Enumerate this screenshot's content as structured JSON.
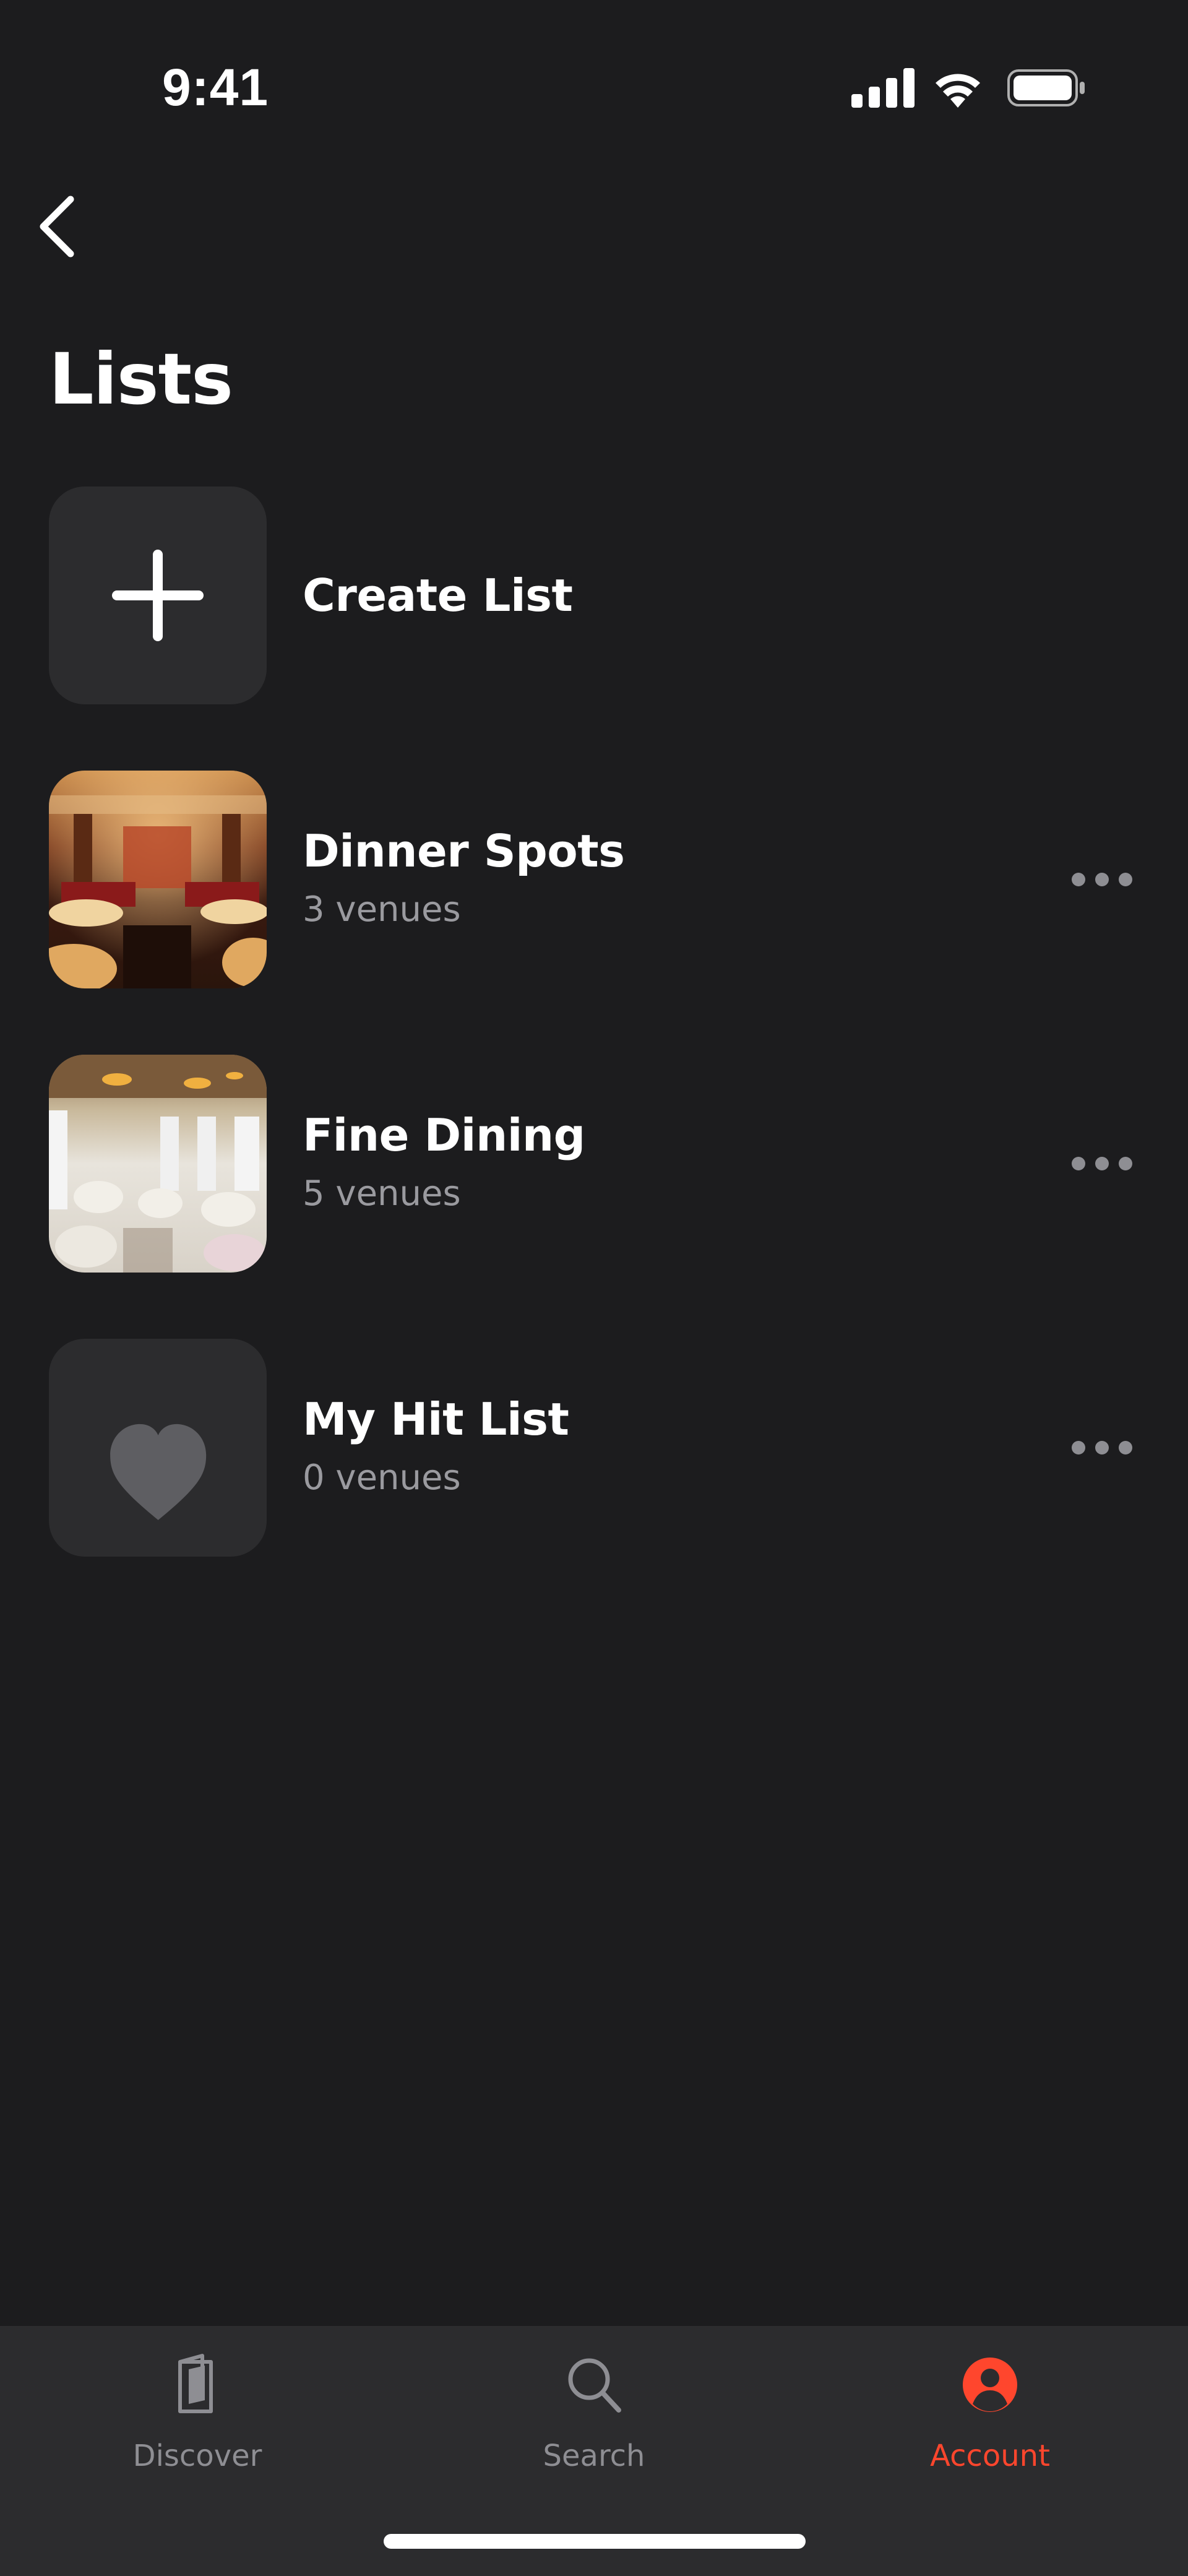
{
  "status_bar": {
    "time": "9:41"
  },
  "header": {
    "title": "Lists"
  },
  "create_list": {
    "label": "Create List"
  },
  "lists": [
    {
      "title": "Dinner Spots",
      "subtitle": "3 venues",
      "thumbnail": "restaurant-photo-warm"
    },
    {
      "title": "Fine Dining",
      "subtitle": "5 venues",
      "thumbnail": "restaurant-photo-bright"
    },
    {
      "title": "My Hit List",
      "subtitle": "0 venues",
      "thumbnail": "heart-icon"
    }
  ],
  "tab_bar": {
    "tabs": [
      {
        "label": "Discover",
        "icon": "book-icon",
        "active": false
      },
      {
        "label": "Search",
        "icon": "search-icon",
        "active": false
      },
      {
        "label": "Account",
        "icon": "account-icon",
        "active": true
      }
    ]
  },
  "colors": {
    "background": "#1c1c1e",
    "card": "#2c2c2e",
    "accent": "#ff462d",
    "secondary_text": "#9a9a9f"
  }
}
